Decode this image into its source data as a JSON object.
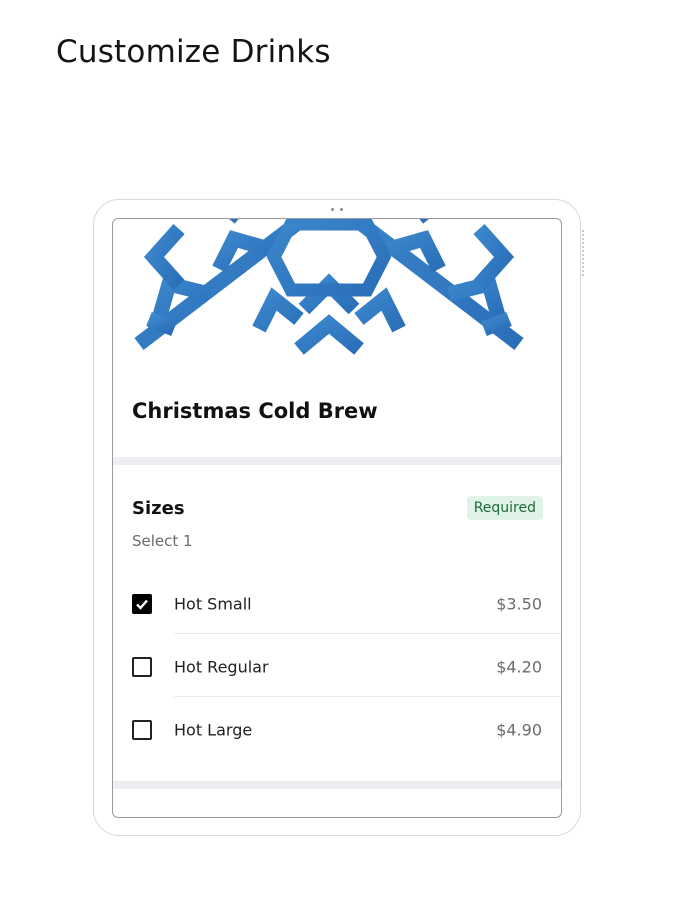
{
  "page": {
    "title": "Customize Drinks"
  },
  "product": {
    "name": "Christmas Cold Brew",
    "image": "snowflake-image"
  },
  "sizes": {
    "title": "Sizes",
    "subtitle": "Select 1",
    "badge": "Required",
    "options": [
      {
        "label": "Hot Small",
        "price": "$3.50",
        "checked": true
      },
      {
        "label": "Hot Regular",
        "price": "$4.20",
        "checked": false
      },
      {
        "label": "Hot Large",
        "price": "$4.90",
        "checked": false
      }
    ]
  },
  "colors": {
    "snowflake": "#2f7bc4",
    "badge_bg": "#dff3e6",
    "badge_text": "#1e6b3a"
  }
}
